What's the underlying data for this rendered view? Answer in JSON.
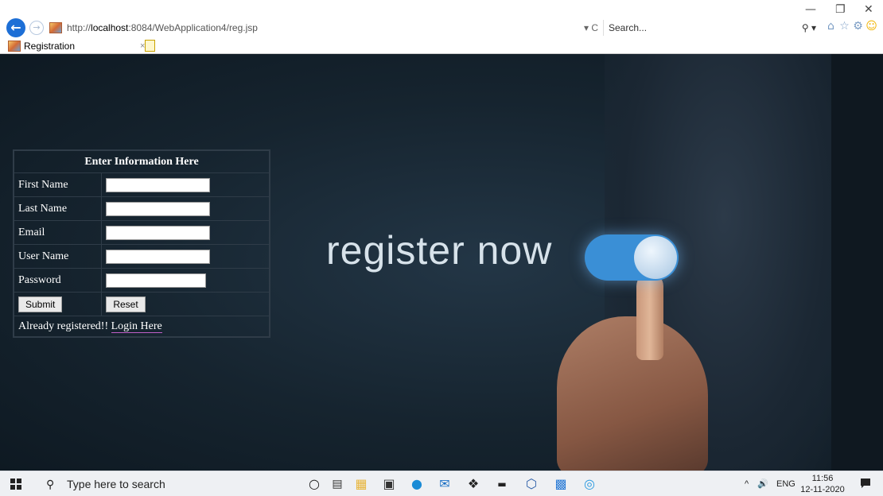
{
  "browser": {
    "url_prefix": "http://",
    "url_host": "localhost",
    "url_rest": ":8084/WebApplication4/reg.jsp",
    "address_controls": "▾ C",
    "search_placeholder": "Search...",
    "search_icon": "⚲ ▾",
    "tab_title": "Registration",
    "tab_close": "×",
    "icons": [
      "back-arrow-icon",
      "forward-arrow-icon",
      "home-icon",
      "star-icon",
      "gear-icon",
      "smiley-icon"
    ]
  },
  "window_controls": {
    "minimize": "—",
    "restore": "❐",
    "close": "✕"
  },
  "hero": {
    "text": "register now"
  },
  "form": {
    "heading": "Enter Information Here",
    "fields": [
      {
        "label": "First Name",
        "value": ""
      },
      {
        "label": "Last Name",
        "value": ""
      },
      {
        "label": "Email",
        "value": ""
      },
      {
        "label": "User Name",
        "value": ""
      },
      {
        "label": "Password",
        "value": ""
      }
    ],
    "submit_label": "Submit",
    "reset_label": "Reset",
    "already_text": "Already registered!! ",
    "login_link": "Login Here"
  },
  "taskbar": {
    "search_placeholder": "Type here to search",
    "apps": [
      "cortana-icon",
      "task-view-icon",
      "file-explorer-icon",
      "store-icon",
      "edge-icon",
      "mail-icon",
      "dropbox-icon",
      "amazon-icon",
      "3d-icon",
      "app-icon",
      "ie-icon"
    ],
    "tray_arrow": "^",
    "volume": "🔊",
    "language": "ENG",
    "time": "11:56",
    "date": "12-11-2020"
  },
  "colors": {
    "accent": "#1d6fd6",
    "toggle": "#3a8fd6",
    "background": "#16242f"
  }
}
